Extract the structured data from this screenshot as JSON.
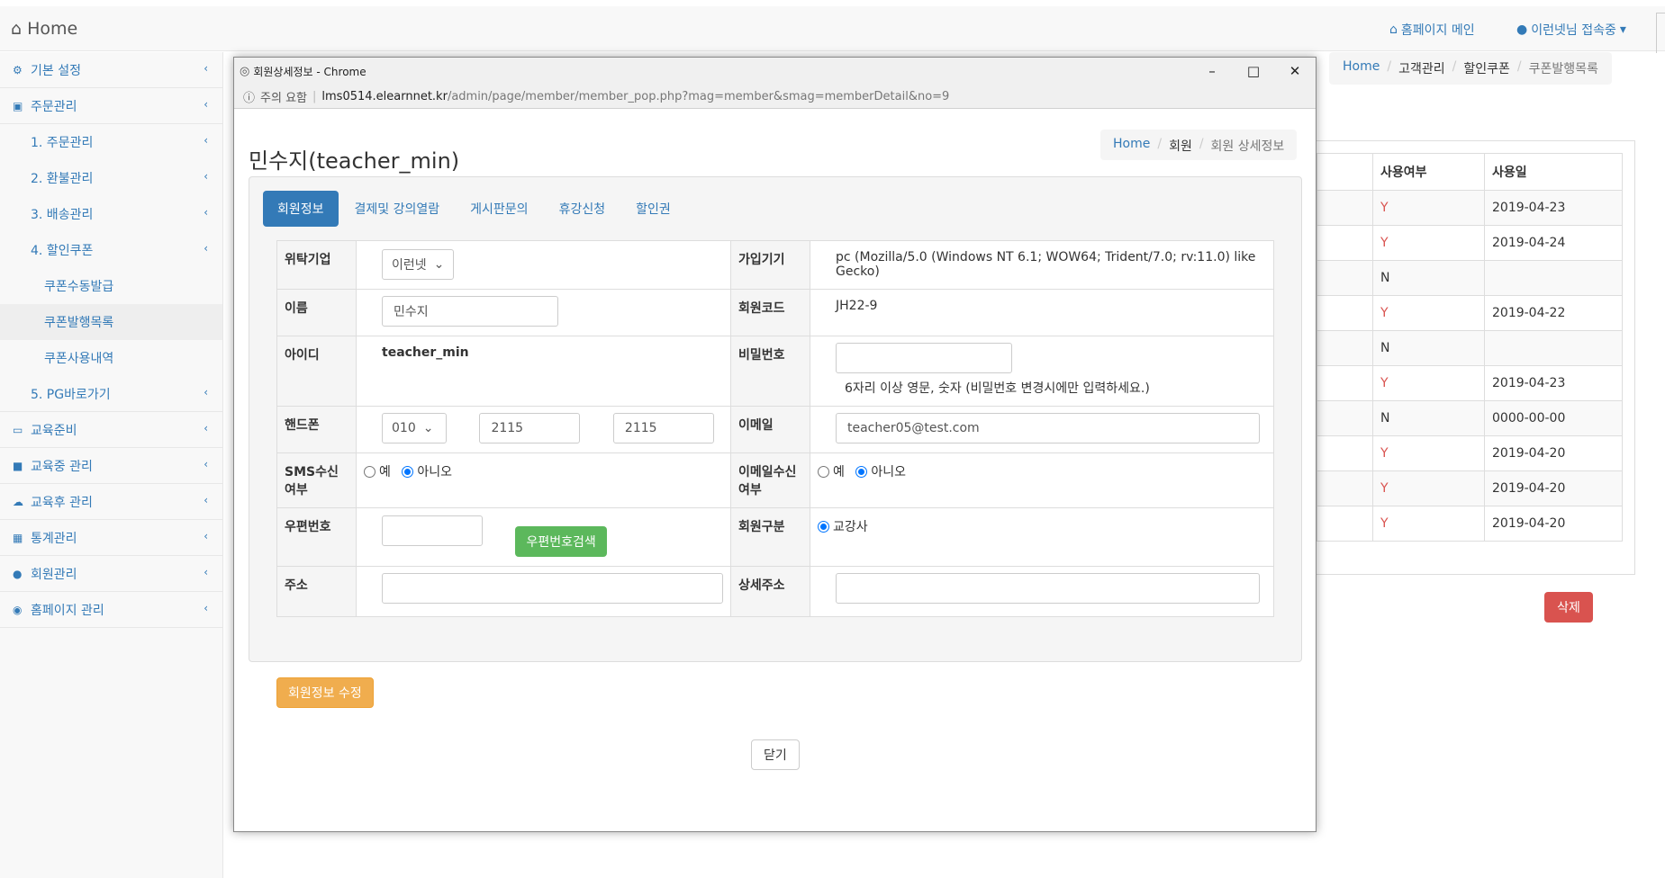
{
  "topbar": {
    "brand": "Home",
    "homepage_main": "홈페이지 메인",
    "user_status": "이런넷님 접속중"
  },
  "sidebar": {
    "items": [
      {
        "label": "기본 설정",
        "icon": "gears-icon"
      },
      {
        "label": "주문관리",
        "icon": "cart-icon"
      },
      {
        "label": "1. 주문관리"
      },
      {
        "label": "2. 환불관리"
      },
      {
        "label": "3. 배송관리"
      },
      {
        "label": "4. 할인쿠폰"
      },
      {
        "label": "쿠폰수동발급"
      },
      {
        "label": "쿠폰발행목록"
      },
      {
        "label": "쿠폰사용내역"
      },
      {
        "label": "5. PG바로가기"
      },
      {
        "label": "교육준비",
        "icon": "laptop-icon"
      },
      {
        "label": "교육중 관리",
        "icon": "folder-open-icon"
      },
      {
        "label": "교육후 관리",
        "icon": "cloud-upload-icon"
      },
      {
        "label": "통계관리",
        "icon": "bar-chart-icon"
      },
      {
        "label": "회원관리",
        "icon": "user-icon"
      },
      {
        "label": "홈페이지 관리",
        "icon": "dashboard-icon"
      }
    ]
  },
  "main": {
    "breadcrumb": [
      "Home",
      "고객관리",
      "할인쿠폰",
      "쿠폰발행목록"
    ],
    "table": {
      "headers": [
        "사용여부",
        "사용일"
      ],
      "rows": [
        [
          "Y",
          "2019-04-23"
        ],
        [
          "Y",
          "2019-04-24"
        ],
        [
          "N",
          ""
        ],
        [
          "Y",
          "2019-04-22"
        ],
        [
          "N",
          ""
        ],
        [
          "Y",
          "2019-04-23"
        ],
        [
          "N",
          "0000-00-00"
        ],
        [
          "Y",
          "2019-04-20"
        ],
        [
          "Y",
          "2019-04-20"
        ],
        [
          "Y",
          "2019-04-20"
        ]
      ]
    },
    "delete_label": "삭제"
  },
  "popup": {
    "window_title": "회원상세정보 - Chrome",
    "security_warning": "주의 요함",
    "url_host": "lms0514.elearnnet.kr",
    "url_path": "/admin/page/member/member_pop.php?mag=member&smag=memberDetail&no=9",
    "page_title": "민수지(teacher_min)",
    "breadcrumb": [
      "Home",
      "회원",
      "회원 상세정보"
    ],
    "tabs": [
      "회원정보",
      "결제및 강의열람",
      "게시판문의",
      "휴강신청",
      "할인권"
    ],
    "form": {
      "company_label": "위탁기업",
      "company_value": "이런넷",
      "device_label": "가입기기",
      "device_value": "pc (Mozilla/5.0 (Windows NT 6.1; WOW64; Trident/7.0; rv:11.0) like Gecko)",
      "name_label": "이름",
      "name_value": "민수지",
      "code_label": "회원코드",
      "code_value": "JH22-9",
      "id_label": "아이디",
      "id_value": "teacher_min",
      "password_label": "비밀번호",
      "password_hint": "6자리 이상 영문, 숫자 (비밀번호 변경시에만 입력하세요.)",
      "phone_label": "핸드폰",
      "phone1": "010",
      "phone2": "2115",
      "phone3": "2115",
      "email_label": "이메일",
      "email_value": "teacher05@test.com",
      "sms_label": "SMS수신여부",
      "email_recv_label": "이메일수신여부",
      "yes": "예",
      "no": "아니오",
      "zip_label": "우편번호",
      "zip_search": "우편번호검색",
      "member_type_label": "회원구분",
      "member_type_value": "교강사",
      "address_label": "주소",
      "detail_address_label": "상세주소"
    },
    "update_button": "회원정보 수정",
    "close_button": "닫기"
  }
}
